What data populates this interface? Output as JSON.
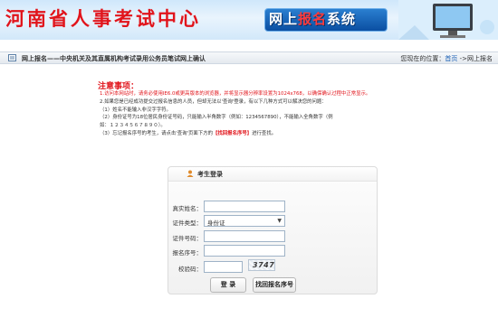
{
  "banner": {
    "title": "河南省人事考试中心",
    "system_part1": "网上",
    "system_part2": "报名",
    "system_part3": "系统"
  },
  "breadcrumb": {
    "page_title": "网上报名——中央机关及其直属机构考试录用公务员笔试网上确认",
    "location_label": "您现在的位置：",
    "home_link": "首页",
    "separator": " ->",
    "current": "网上报名"
  },
  "notice": {
    "title": "注意事项：",
    "line1": "1.访问本网站时，请务必使用IE6.0或更高版本的浏览器，并将显示器分辨率设置为1024x768，以确保确认过程中正常显示。",
    "line2": "2.如果您是已经成功提交过报名信息的人员，但却无法以'查询'登录，有以下几种方式可以解决您的问题：",
    "line3": "（1）姓名不能输入非汉字字符。",
    "line4": "（2）身份证号为18位居民身份证号码，只能输入半角数字（例如：1234567890），不能输入全角数字（例",
    "line5": "如：１２３４５６７８９０）。",
    "line6_prefix": "（3）忘记报名序号的考生，请点击'查询'页面下方的",
    "line6_link": "【找回报名序号】",
    "line6_suffix": "进行查找。"
  },
  "login": {
    "title": "考生登录",
    "name_label": "真实姓名：",
    "name_value": "",
    "idtype_label": "证件类型：",
    "idtype_value": "身份证",
    "idnum_label": "证件号码：",
    "idnum_value": "",
    "regnum_label": "报名序号：",
    "regnum_value": "",
    "captcha_label": "校验码：",
    "captcha_value": "",
    "captcha_text": "3747",
    "login_button": "登 录",
    "recover_button": "找回报名序号"
  },
  "colors": {
    "brand_red": "#e1141b",
    "link_blue": "#1a5fb4"
  }
}
